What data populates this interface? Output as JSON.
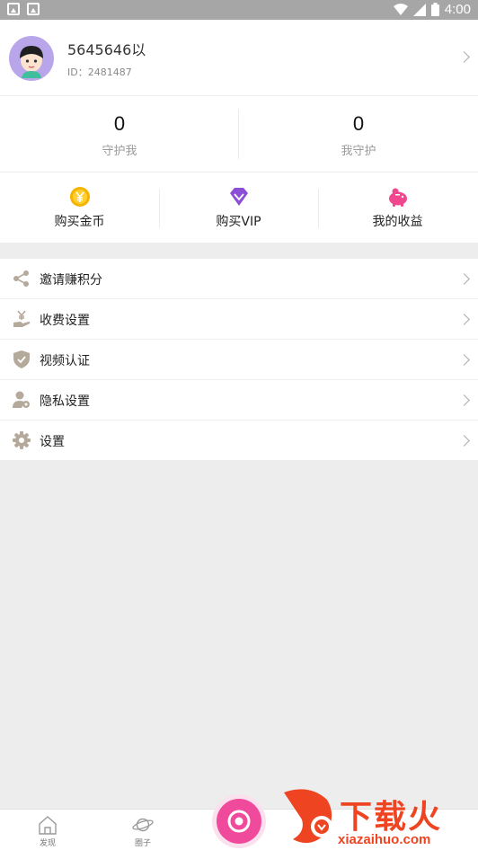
{
  "status_bar": {
    "time": "4:00"
  },
  "profile": {
    "nickname": "5645646以",
    "id_text": "ID：2481487"
  },
  "stats": [
    {
      "value": "0",
      "label": "守护我"
    },
    {
      "value": "0",
      "label": "我守护"
    }
  ],
  "actions": [
    {
      "label": "购买金币",
      "icon": "gold-coin-icon",
      "color": "#f5b400"
    },
    {
      "label": "购买VIP",
      "icon": "diamond-icon",
      "color": "#8a4fd6"
    },
    {
      "label": "我的收益",
      "icon": "piggy-bank-icon",
      "color": "#f0478e"
    }
  ],
  "menu": [
    {
      "label": "邀请赚积分",
      "icon": "share-icon"
    },
    {
      "label": "收费设置",
      "icon": "yen-hand-icon"
    },
    {
      "label": "视频认证",
      "icon": "shield-check-icon"
    },
    {
      "label": "隐私设置",
      "icon": "user-settings-icon"
    },
    {
      "label": "设置",
      "icon": "gear-icon"
    }
  ],
  "tabbar": [
    {
      "label": "发现",
      "icon": "home-icon"
    },
    {
      "label": "圈子",
      "icon": "planet-icon"
    }
  ],
  "watermark": {
    "title": "下载火",
    "url": "xiazaihuo.com"
  },
  "colors": {
    "accent": "#f04a9c",
    "icon_gray": "#b5a99c",
    "background": "#ededed"
  }
}
